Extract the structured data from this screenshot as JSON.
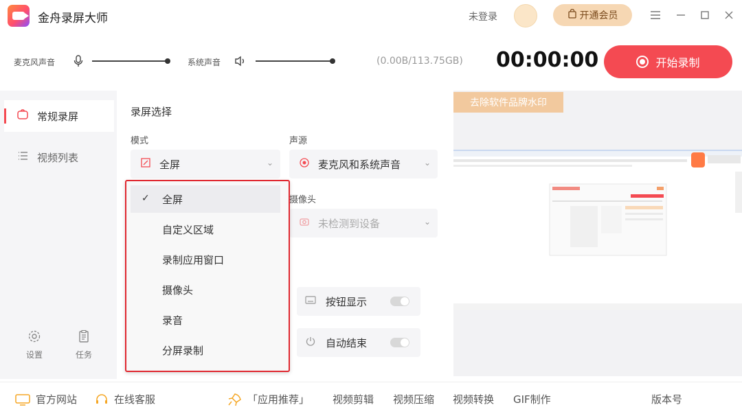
{
  "app": {
    "title": "金舟录屏大师"
  },
  "header": {
    "login": "未登录",
    "vip_label": "开通会员"
  },
  "audio": {
    "mic_label": "麦克风声音",
    "system_label": "系统声音",
    "storage": "(0.00B/113.75GB)",
    "timer": "00:00:00",
    "record_label": "开始录制"
  },
  "nav": {
    "items": [
      {
        "label": "常规录屏",
        "icon": "record-icon"
      },
      {
        "label": "视频列表",
        "icon": "list-icon"
      }
    ],
    "settings": "设置",
    "tasks": "任务"
  },
  "settings": {
    "section_title": "录屏选择",
    "mode_label": "模式",
    "mode_value": "全屏",
    "source_label": "声源",
    "source_value": "麦克风和系统声音",
    "camera_label": "摄像头",
    "camera_value": "未检测到设备",
    "button_display": "按钮显示",
    "auto_end": "自动结束"
  },
  "dropdown": {
    "options": [
      "全屏",
      "自定义区域",
      "录制应用窗口",
      "摄像头",
      "录音",
      "分屏录制"
    ],
    "selected": "全屏"
  },
  "preview": {
    "watermark_label": "去除软件品牌水印"
  },
  "footer": {
    "website": "官方网站",
    "support": "在线客服",
    "recommend": "「应用推荐」",
    "edit": "视频剪辑",
    "compress": "视频压缩",
    "convert": "视频转换",
    "gif": "GIF制作",
    "version": "版本号"
  },
  "colors": {
    "accent": "#f44a52",
    "vip": "#f6d7b3",
    "highlight": "#e0262e"
  }
}
